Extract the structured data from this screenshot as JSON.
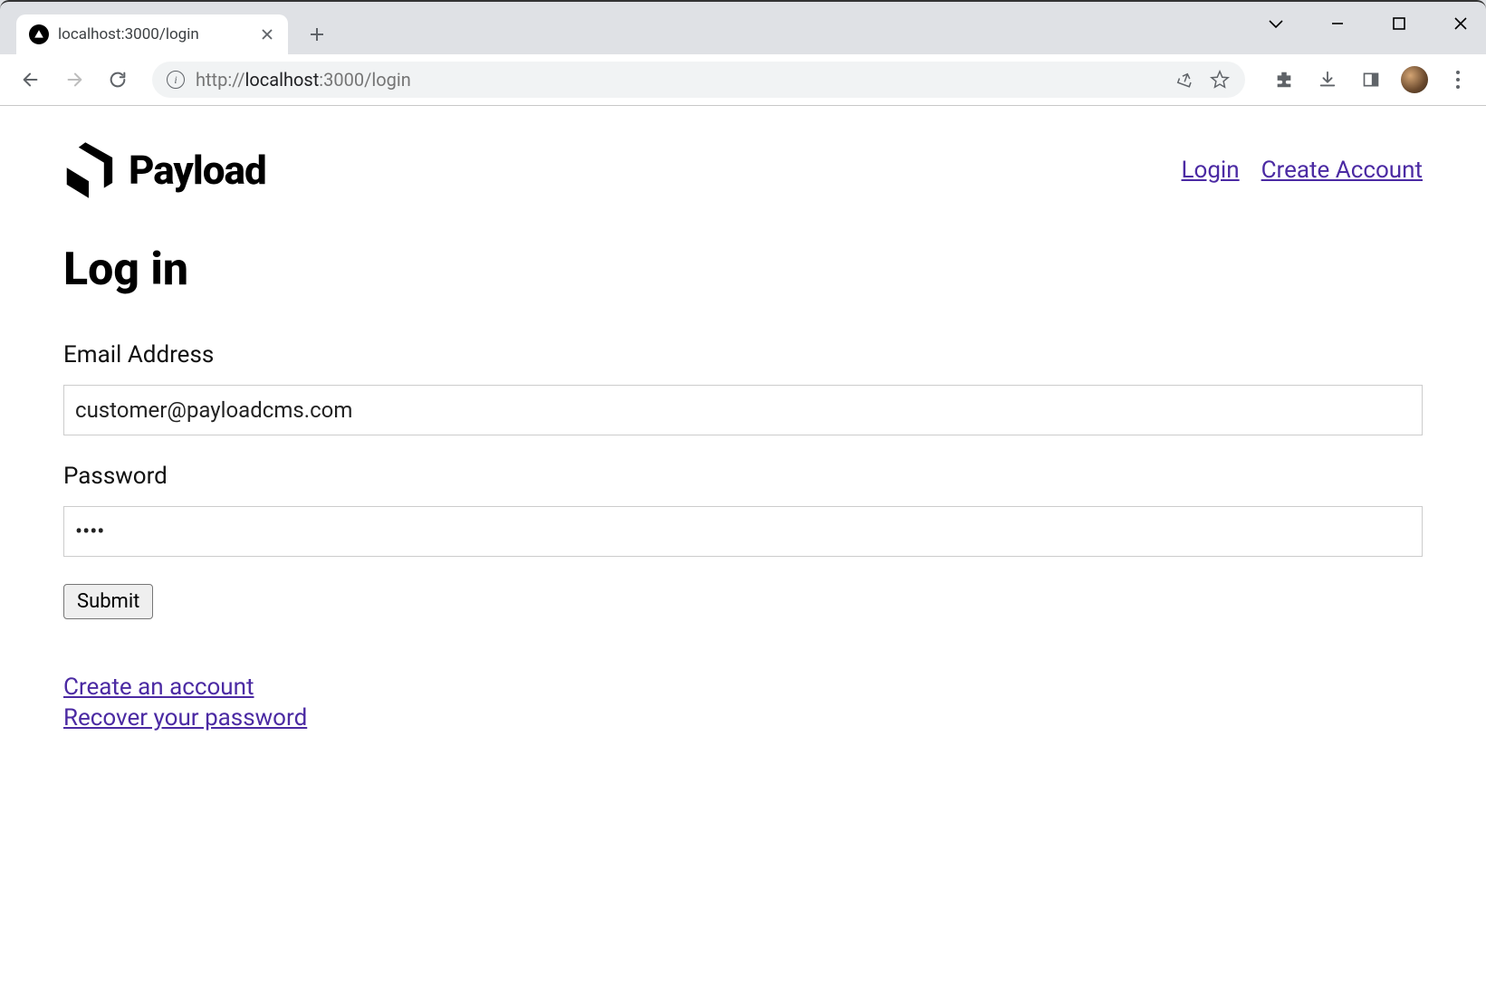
{
  "browser": {
    "tab_title": "localhost:3000/login",
    "url_protocol": "http://",
    "url_host": "localhost",
    "url_port_path": ":3000/login"
  },
  "header": {
    "brand": "Payload",
    "nav": {
      "login": "Login",
      "create_account": "Create Account"
    }
  },
  "page": {
    "title": "Log in"
  },
  "form": {
    "email_label": "Email Address",
    "email_value": "customer@payloadcms.com",
    "password_label": "Password",
    "password_value": "test",
    "submit_label": "Submit"
  },
  "links": {
    "create_account": "Create an account",
    "recover_password": "Recover your password"
  }
}
